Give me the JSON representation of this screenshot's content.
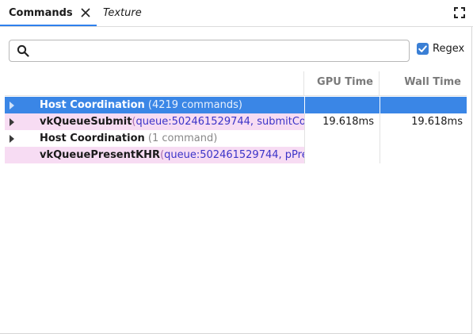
{
  "tabs": {
    "commands_label": "Commands",
    "texture_label": "Texture"
  },
  "search": {
    "value": "",
    "placeholder": ""
  },
  "regex": {
    "label": "Regex",
    "checked": true
  },
  "table": {
    "columns": {
      "gpu_time": "GPU Time",
      "wall_time": "Wall Time"
    },
    "rows": [
      {
        "name": "Host Coordination",
        "meta": "(4219 commands)",
        "selected": true,
        "gpu_time": "",
        "wall_time": ""
      },
      {
        "name": "vkQueueSubmit",
        "open_paren": "(",
        "param1_key": "queue:",
        "param1_val": "502461529744",
        "sep": ",",
        "param2_key": "submitCount",
        "gpu_time": "19.618ms",
        "wall_time": "19.618ms"
      },
      {
        "name": "Host Coordination",
        "meta": "(1 command)",
        "gpu_time": "",
        "wall_time": ""
      },
      {
        "name": "vkQueuePresentKHR",
        "open_paren": "(",
        "param1_key": "queue:",
        "param1_val": "502461529744",
        "sep": ",",
        "param2_key": "pPresentInfo",
        "gpu_time": "",
        "wall_time": ""
      }
    ]
  },
  "icons": {
    "close": "close-icon",
    "maximize": "maximize-icon",
    "search": "search-icon",
    "expander": "triangle-right-icon",
    "checkmark": "checkmark-icon"
  },
  "colors": {
    "accent": "#3a86e6",
    "checkbox": "#3a7fd5",
    "command_row_bg": "#f7dcf3",
    "param_text": "#3c34c8"
  }
}
